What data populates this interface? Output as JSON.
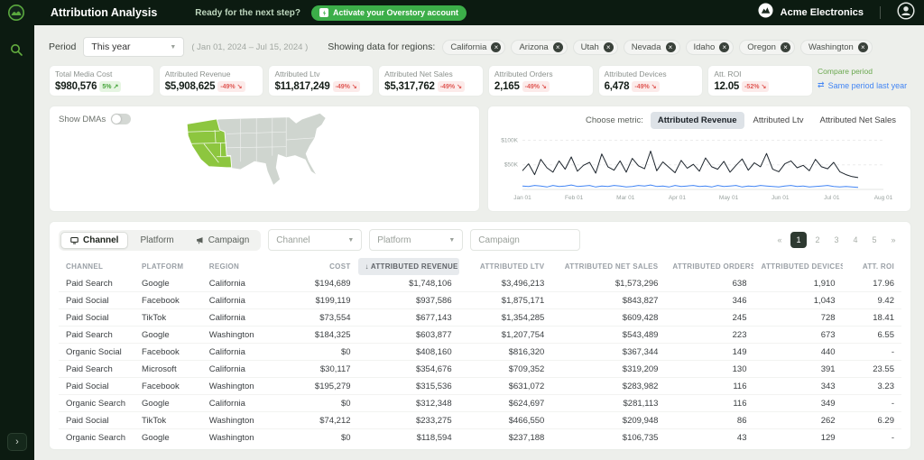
{
  "header": {
    "title": "Attribution Analysis",
    "prompt": "Ready for the next step?",
    "cta_label": "Activate your Overstory account",
    "company_name": "Acme Electronics"
  },
  "filters": {
    "period_label": "Period",
    "period_value": "This year",
    "date_range": "( Jan 01, 2024 – Jul 15, 2024 )",
    "regions_label": "Showing data for regions:",
    "regions": [
      "California",
      "Arizona",
      "Utah",
      "Nevada",
      "Idaho",
      "Oregon",
      "Washington"
    ]
  },
  "kpis": [
    {
      "label": "Total Media Cost",
      "value": "$980,576",
      "delta": "5%",
      "direction": "up"
    },
    {
      "label": "Attributed Revenue",
      "value": "$5,908,625",
      "delta": "-49%",
      "direction": "down"
    },
    {
      "label": "Attributed Ltv",
      "value": "$11,817,249",
      "delta": "-49%",
      "direction": "down"
    },
    {
      "label": "Attributed Net Sales",
      "value": "$5,317,762",
      "delta": "-49%",
      "direction": "down"
    },
    {
      "label": "Attributed Orders",
      "value": "2,165",
      "delta": "-49%",
      "direction": "down"
    },
    {
      "label": "Attributed Devices",
      "value": "6,478",
      "delta": "-49%",
      "direction": "down"
    },
    {
      "label": "Att. ROI",
      "value": "12.05",
      "delta": "-52%",
      "direction": "down"
    }
  ],
  "compare_period": {
    "label": "Compare period",
    "link_label": "Same period last year"
  },
  "map_panel": {
    "toggle_label": "Show DMAs",
    "highlighted_states": [
      "California",
      "Arizona",
      "Utah",
      "Nevada",
      "Idaho",
      "Oregon",
      "Washington"
    ],
    "highlight_color": "#8dc63f"
  },
  "chart_panel": {
    "label": "Choose metric:",
    "tabs": [
      "Attributed Revenue",
      "Attributed Ltv",
      "Attributed Net Sales"
    ],
    "active_tab": "Attributed Revenue",
    "chart_data": {
      "type": "line",
      "x_ticks": [
        "Jan 01",
        "Feb 01",
        "Mar 01",
        "Apr 01",
        "May 01",
        "Jun 01",
        "Jul 01",
        "Aug 01"
      ],
      "y_ticks": [
        "$100K",
        "$50K"
      ],
      "ylim_thousands": [
        0,
        110
      ],
      "data_end_fraction": 0.93,
      "series": [
        {
          "name": "Attributed Revenue",
          "color": "#1c242c",
          "values_thousands": [
            38,
            52,
            30,
            61,
            44,
            35,
            58,
            41,
            66,
            37,
            49,
            55,
            33,
            72,
            46,
            39,
            58,
            35,
            63,
            48,
            42,
            78,
            38,
            56,
            45,
            34,
            59,
            43,
            51,
            37,
            64,
            46,
            41,
            57,
            35,
            49,
            62,
            39,
            54,
            46,
            73,
            41,
            36,
            52,
            58,
            44,
            49,
            38,
            61,
            46,
            42,
            55,
            36,
            30,
            26,
            24
          ]
        },
        {
          "name": "Media Cost",
          "color": "#4285f4",
          "values_thousands": [
            7,
            6,
            8,
            7,
            5,
            8,
            6,
            7,
            9,
            6,
            7,
            8,
            5,
            7,
            6,
            8,
            7,
            5,
            6,
            8,
            7,
            9,
            6,
            7,
            5,
            8,
            6,
            7,
            8,
            6,
            7,
            5,
            8,
            6,
            7,
            8,
            5,
            7,
            6,
            8,
            7,
            6,
            5,
            7,
            8,
            6,
            7,
            5,
            6,
            7,
            8,
            6,
            5,
            6,
            5,
            4
          ]
        }
      ]
    }
  },
  "table_panel": {
    "tabs": [
      "Channel",
      "Platform",
      "Campaign"
    ],
    "active_tab": "Channel",
    "channel_filter_placeholder": "Channel",
    "platform_filter_placeholder": "Platform",
    "campaign_filter_placeholder": "Campaign",
    "pagination": {
      "prev": "«",
      "pages": [
        "1",
        "2",
        "3",
        "4",
        "5"
      ],
      "next": "»",
      "active_page": "1"
    },
    "columns": [
      "CHANNEL",
      "PLATFORM",
      "REGION",
      "COST",
      "ATTRIBUTED REVENUE",
      "ATTRIBUTED LTV",
      "ATTRIBUTED NET SALES",
      "ATTRIBUTED ORDERS",
      "ATTRIBUTED DEVICES",
      "ATT. ROI"
    ],
    "sorted_column": "ATTRIBUTED REVENUE",
    "rows": [
      [
        "Paid Search",
        "Google",
        "California",
        "$194,689",
        "$1,748,106",
        "$3,496,213",
        "$1,573,296",
        "638",
        "1,910",
        "17.96"
      ],
      [
        "Paid Social",
        "Facebook",
        "California",
        "$199,119",
        "$937,586",
        "$1,875,171",
        "$843,827",
        "346",
        "1,043",
        "9.42"
      ],
      [
        "Paid Social",
        "TikTok",
        "California",
        "$73,554",
        "$677,143",
        "$1,354,285",
        "$609,428",
        "245",
        "728",
        "18.41"
      ],
      [
        "Paid Search",
        "Google",
        "Washington",
        "$184,325",
        "$603,877",
        "$1,207,754",
        "$543,489",
        "223",
        "673",
        "6.55"
      ],
      [
        "Organic Social",
        "Facebook",
        "California",
        "$0",
        "$408,160",
        "$816,320",
        "$367,344",
        "149",
        "440",
        "-"
      ],
      [
        "Paid Search",
        "Microsoft",
        "California",
        "$30,117",
        "$354,676",
        "$709,352",
        "$319,209",
        "130",
        "391",
        "23.55"
      ],
      [
        "Paid Social",
        "Facebook",
        "Washington",
        "$195,279",
        "$315,536",
        "$631,072",
        "$283,982",
        "116",
        "343",
        "3.23"
      ],
      [
        "Organic Search",
        "Google",
        "California",
        "$0",
        "$312,348",
        "$624,697",
        "$281,113",
        "116",
        "349",
        "-"
      ],
      [
        "Paid Social",
        "TikTok",
        "Washington",
        "$74,212",
        "$233,275",
        "$466,550",
        "$209,948",
        "86",
        "262",
        "6.29"
      ],
      [
        "Organic Search",
        "Google",
        "Washington",
        "$0",
        "$118,594",
        "$237,188",
        "$106,735",
        "43",
        "129",
        "-"
      ]
    ]
  }
}
